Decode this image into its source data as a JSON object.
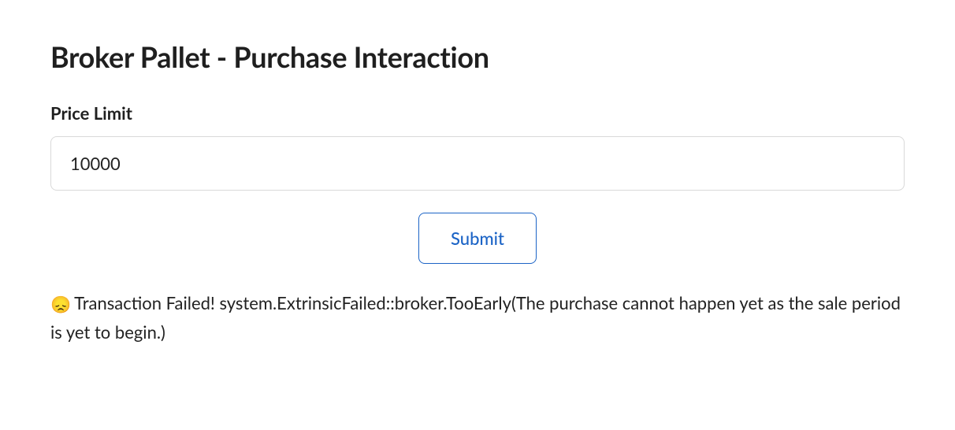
{
  "header": {
    "title": "Broker Pallet - Purchase Interaction"
  },
  "form": {
    "price_limit_label": "Price Limit",
    "price_limit_value": "10000",
    "submit_label": "Submit"
  },
  "status": {
    "emoji": "😞",
    "message": "Transaction Failed! system.ExtrinsicFailed::broker.TooEarly(The purchase cannot happen yet as the sale period is yet to begin.)"
  }
}
